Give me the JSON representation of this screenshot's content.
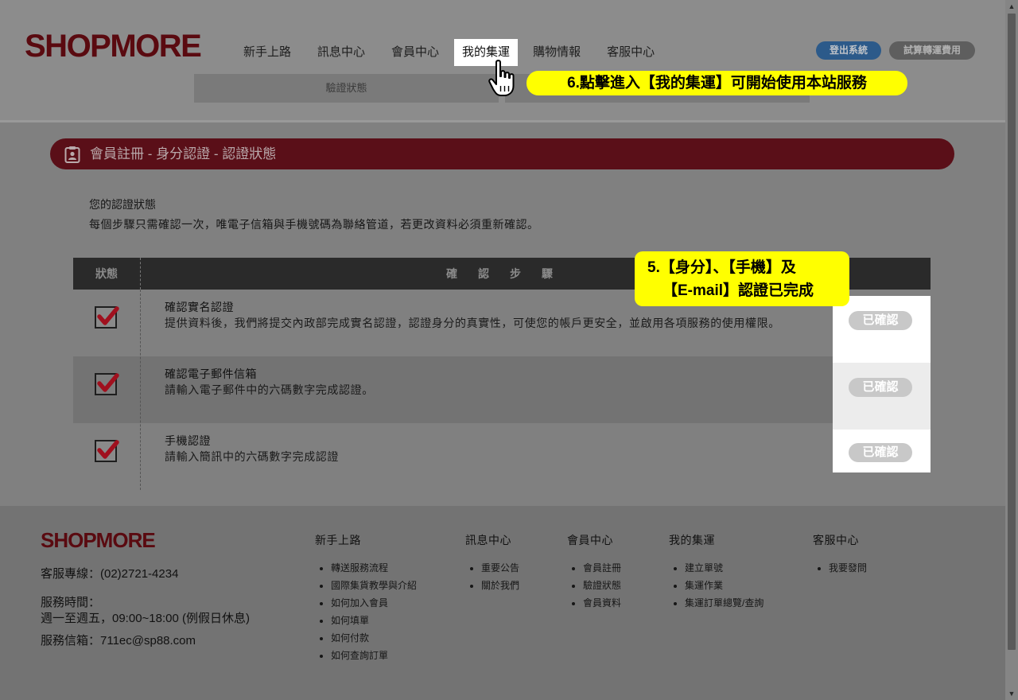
{
  "header": {
    "logo": "SHOPMORE",
    "nav": [
      {
        "label": "新手上路",
        "active": false
      },
      {
        "label": "訊息中心",
        "active": false
      },
      {
        "label": "會員中心",
        "active": false
      },
      {
        "label": "我的集運",
        "active": true
      },
      {
        "label": "購物情報",
        "active": false
      },
      {
        "label": "客服中心",
        "active": false
      }
    ],
    "logout_label": "登出系統",
    "shipping_calc_label": "試算轉運費用",
    "submenu_label": "驗證狀態"
  },
  "callouts": {
    "step6": "6.點擊進入【我的集運】可開始使用本站服務",
    "step5_line1": "5.【身分】、【手機】及",
    "step5_line2": "【E-mail】認證已完成"
  },
  "section_title": "會員註冊 - 身分認證 - 認證狀態",
  "intro": {
    "title": "您的認證狀態",
    "text": "每個步驟只需確認一次，唯電子信箱與手機號碼為聯絡管道，若更改資料必須重新確認。"
  },
  "table": {
    "header_status": "狀態",
    "header_steps": "確　認　步　驟",
    "rows": [
      {
        "title": "確認實名認證",
        "desc": "提供資料後，我們將提交內政部完成實名認證，認證身分的真實性，可使您的帳戶更安全，並啟用各項服務的使用權限。",
        "status": "已確認"
      },
      {
        "title": "確認電子郵件信箱",
        "desc": "請輸入電子郵件中的六碼數字完成認證。",
        "status": "已確認"
      },
      {
        "title": "手機認證",
        "desc": "請輸入簡訊中的六碼數字完成認證",
        "status": "已確認"
      }
    ]
  },
  "footer": {
    "logo": "SHOPMORE",
    "phone": "客服專線：(02)2721-4234",
    "hours_label": "服務時間：",
    "hours": "週一至週五，09:00~18:00 (例假日休息)",
    "email": "服務信箱：711ec@sp88.com",
    "columns": [
      {
        "title": "新手上路",
        "links": [
          "轉送服務流程",
          "國際集貨教學與介紹",
          "如何加入會員",
          "如何填單",
          "如何付款",
          "如何查詢訂單"
        ]
      },
      {
        "title": "訊息中心",
        "links": [
          "重要公告",
          "關於我們"
        ]
      },
      {
        "title": "會員中心",
        "links": [
          "會員註冊",
          "驗證狀態",
          "會員資料"
        ]
      },
      {
        "title": "我的集運",
        "links": [
          "建立單號",
          "集運作業",
          "集運訂單總覽/查詢"
        ]
      },
      {
        "title": "客服中心",
        "links": [
          "我要發問"
        ]
      }
    ]
  },
  "colors": {
    "brand_red": "#5a0a10",
    "overlay_grey": "#808080",
    "callout_yellow": "#ffff00",
    "logout_blue": "#2c5a8a",
    "check_red": "#a0101e"
  },
  "icons": {
    "pointer": "hand-pointer-icon",
    "section": "clipboard-id-icon",
    "check": "checkbox-checked-icon"
  }
}
